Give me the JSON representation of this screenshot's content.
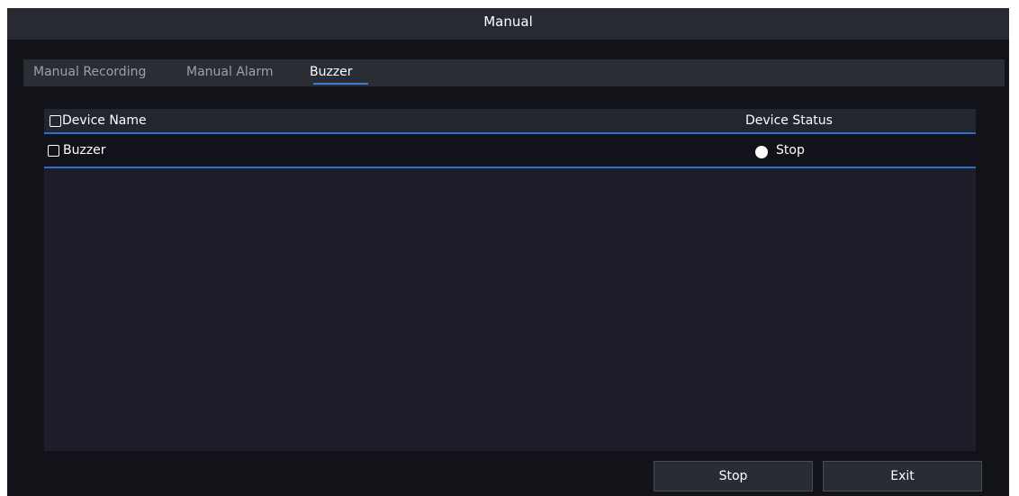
{
  "window": {
    "title": "Manual"
  },
  "tabs": [
    {
      "label": "Manual Recording",
      "active": false
    },
    {
      "label": "Manual Alarm",
      "active": false
    },
    {
      "label": "Buzzer",
      "active": true
    }
  ],
  "table": {
    "headers": {
      "device_name": "Device Name",
      "device_status": "Device Status"
    },
    "rows": [
      {
        "device_name": "Buzzer",
        "status": "Stop",
        "checked": false
      }
    ]
  },
  "buttons": {
    "stop": "Stop",
    "exit": "Exit"
  },
  "colors": {
    "accent": "#2e6fd1",
    "background": "#121219",
    "titlebar": "#282a33"
  }
}
